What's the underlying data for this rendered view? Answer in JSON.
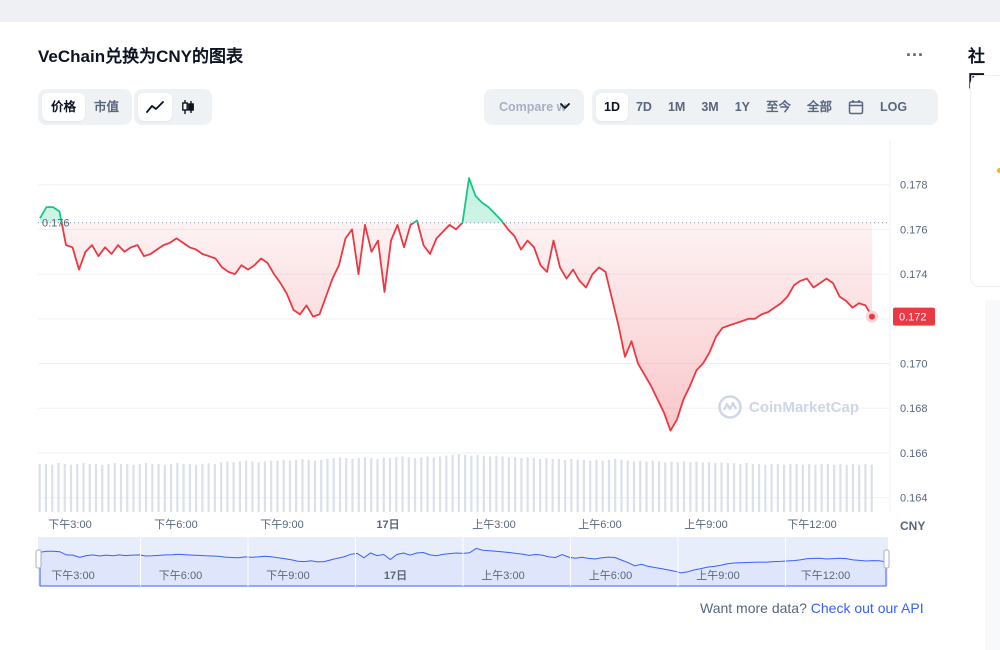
{
  "title": "VeChain兑换为CNY的图表",
  "more_label": "...",
  "side_title": "社区",
  "type_tabs": [
    {
      "label": "价格",
      "active": true
    },
    {
      "label": "市值",
      "active": false
    }
  ],
  "style_tabs": [
    {
      "icon": "line-chart-icon",
      "active": true
    },
    {
      "icon": "candlestick-icon",
      "active": false
    }
  ],
  "compare_label": "Compare w",
  "range_tabs": [
    {
      "label": "1D",
      "active": true
    },
    {
      "label": "7D"
    },
    {
      "label": "1M"
    },
    {
      "label": "3M"
    },
    {
      "label": "1Y"
    },
    {
      "label": "至今"
    },
    {
      "label": "全部"
    },
    {
      "label": "",
      "icon": "calendar-icon"
    },
    {
      "label": "LOG"
    }
  ],
  "watermark": "CoinMarketCap",
  "footer": {
    "text": "Want more data? ",
    "link": "Check out our API"
  },
  "colors": {
    "up": "#16c784",
    "down": "#ea3943",
    "volume": "#cfd6e4",
    "navigator": "#dfe5fb"
  },
  "chart_data": {
    "type": "line",
    "currency": "CNY",
    "ylim": [
      0.163,
      0.18
    ],
    "y_ticks": [
      "0.178",
      "0.176",
      "0.174",
      "0.172",
      "0.170",
      "0.168",
      "0.166",
      "0.164"
    ],
    "x_ticks": [
      "下午3:00",
      "下午6:00",
      "下午9:00",
      "17日",
      "上午3:00",
      "上午6:00",
      "上午9:00",
      "下午12:00"
    ],
    "open_price": 0.1763,
    "open_label": "0.176",
    "current_price": 0.1721,
    "current_label": "0.172",
    "series": [
      {
        "values": [
          0.1765,
          0.177,
          0.177,
          0.1768,
          0.1753,
          0.1752,
          0.1742,
          0.175,
          0.1753,
          0.1748,
          0.1752,
          0.1749,
          0.1753,
          0.175,
          0.1752,
          0.1753,
          0.1748,
          0.1749,
          0.1751,
          0.1753,
          0.1754,
          0.1756,
          0.1754,
          0.1752,
          0.1751,
          0.1749,
          0.1748,
          0.1747,
          0.1743,
          0.1741,
          0.174,
          0.1744,
          0.1742,
          0.1744,
          0.1747,
          0.1745,
          0.174,
          0.1736,
          0.1731,
          0.1724,
          0.1722,
          0.1726,
          0.1721,
          0.1722,
          0.173,
          0.1738,
          0.1744,
          0.1756,
          0.176,
          0.174,
          0.1762,
          0.175,
          0.1755,
          0.1732,
          0.1755,
          0.1762,
          0.1752,
          0.1762,
          0.1764,
          0.1753,
          0.1749,
          0.1756,
          0.1759,
          0.1762,
          0.176,
          0.1763,
          0.1783,
          0.1775,
          0.1772,
          0.177,
          0.1767,
          0.1764,
          0.176,
          0.1757,
          0.1751,
          0.1755,
          0.1752,
          0.1744,
          0.1741,
          0.1755,
          0.1743,
          0.1738,
          0.1742,
          0.1737,
          0.1734,
          0.174,
          0.1743,
          0.1741,
          0.1729,
          0.1717,
          0.1703,
          0.171,
          0.17,
          0.1695,
          0.169,
          0.1684,
          0.1678,
          0.167,
          0.1675,
          0.1684,
          0.169,
          0.1697,
          0.17,
          0.1705,
          0.1712,
          0.1716,
          0.1717,
          0.1718,
          0.1719,
          0.172,
          0.172,
          0.1722,
          0.1723,
          0.1725,
          0.1727,
          0.173,
          0.1735,
          0.1737,
          0.1738,
          0.1734,
          0.1736,
          0.1738,
          0.1736,
          0.173,
          0.1728,
          0.1725,
          0.1727,
          0.1726,
          0.1721
        ]
      }
    ],
    "volume": [
      58,
      58,
      57,
      59,
      58,
      57,
      58,
      59,
      58,
      58,
      57,
      58,
      59,
      58,
      58,
      57,
      58,
      59,
      58,
      58,
      57,
      58,
      59,
      58,
      58,
      57,
      58,
      59,
      58,
      60,
      61,
      60,
      61,
      62,
      61,
      60,
      61,
      62,
      62,
      63,
      62,
      63,
      64,
      63,
      62,
      63,
      64,
      65,
      66,
      65,
      64,
      65,
      66,
      65,
      64,
      66,
      65,
      66,
      67,
      66,
      65,
      66,
      67,
      66,
      67,
      68,
      69,
      70,
      69,
      68,
      69,
      68,
      67,
      68,
      67,
      66,
      66,
      65,
      66,
      65,
      64,
      65,
      64,
      64,
      63,
      64,
      63,
      63,
      62,
      63,
      62,
      63,
      64,
      63,
      62,
      61,
      62,
      61,
      62,
      61,
      60,
      61,
      60,
      61,
      60,
      61,
      60,
      60,
      59,
      60,
      59,
      59,
      58,
      59,
      58,
      58,
      57,
      58,
      58,
      57,
      58,
      58,
      57,
      58,
      57,
      58,
      58,
      57,
      58,
      57,
      58,
      57,
      58,
      57
    ]
  }
}
